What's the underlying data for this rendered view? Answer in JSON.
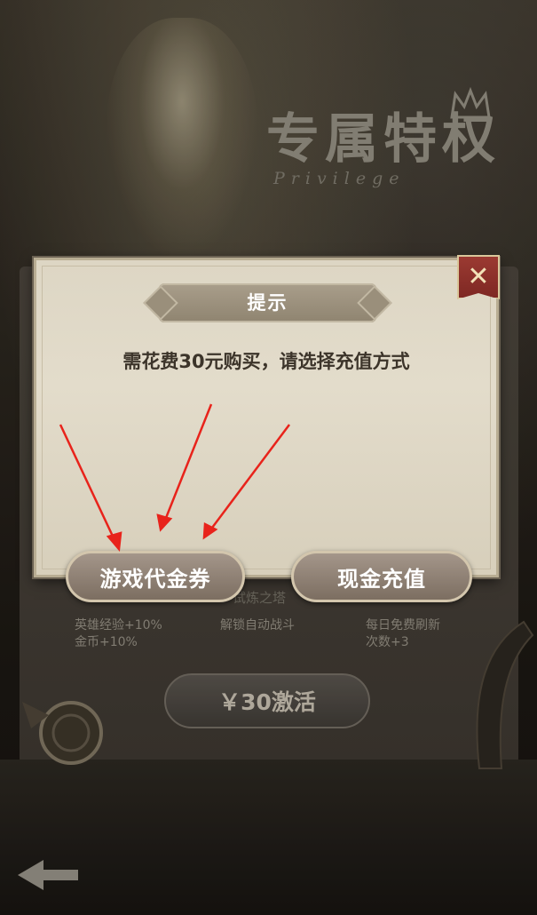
{
  "background": {
    "title": "专属特权",
    "subtitle": "Privilege",
    "perks": [
      {
        "text": "英雄经验+10%\n金币+10%"
      },
      {
        "text": "解锁自动战斗"
      },
      {
        "text": "每日免费刷新\n次数+3"
      }
    ],
    "perk_hidden_label": "试炼之塔",
    "activate_label": "￥30激活"
  },
  "dialog": {
    "title": "提示",
    "message": "需花费30元购买，请选择充值方式",
    "buttons": {
      "voucher": "游戏代金券",
      "cash": "现金充值"
    },
    "close_symbol": "✕"
  },
  "annotation": {
    "arrow_color": "#e8231b",
    "arrow_count": 3
  },
  "icons": [
    "crown-icon",
    "close-icon",
    "back-arrow-icon"
  ]
}
